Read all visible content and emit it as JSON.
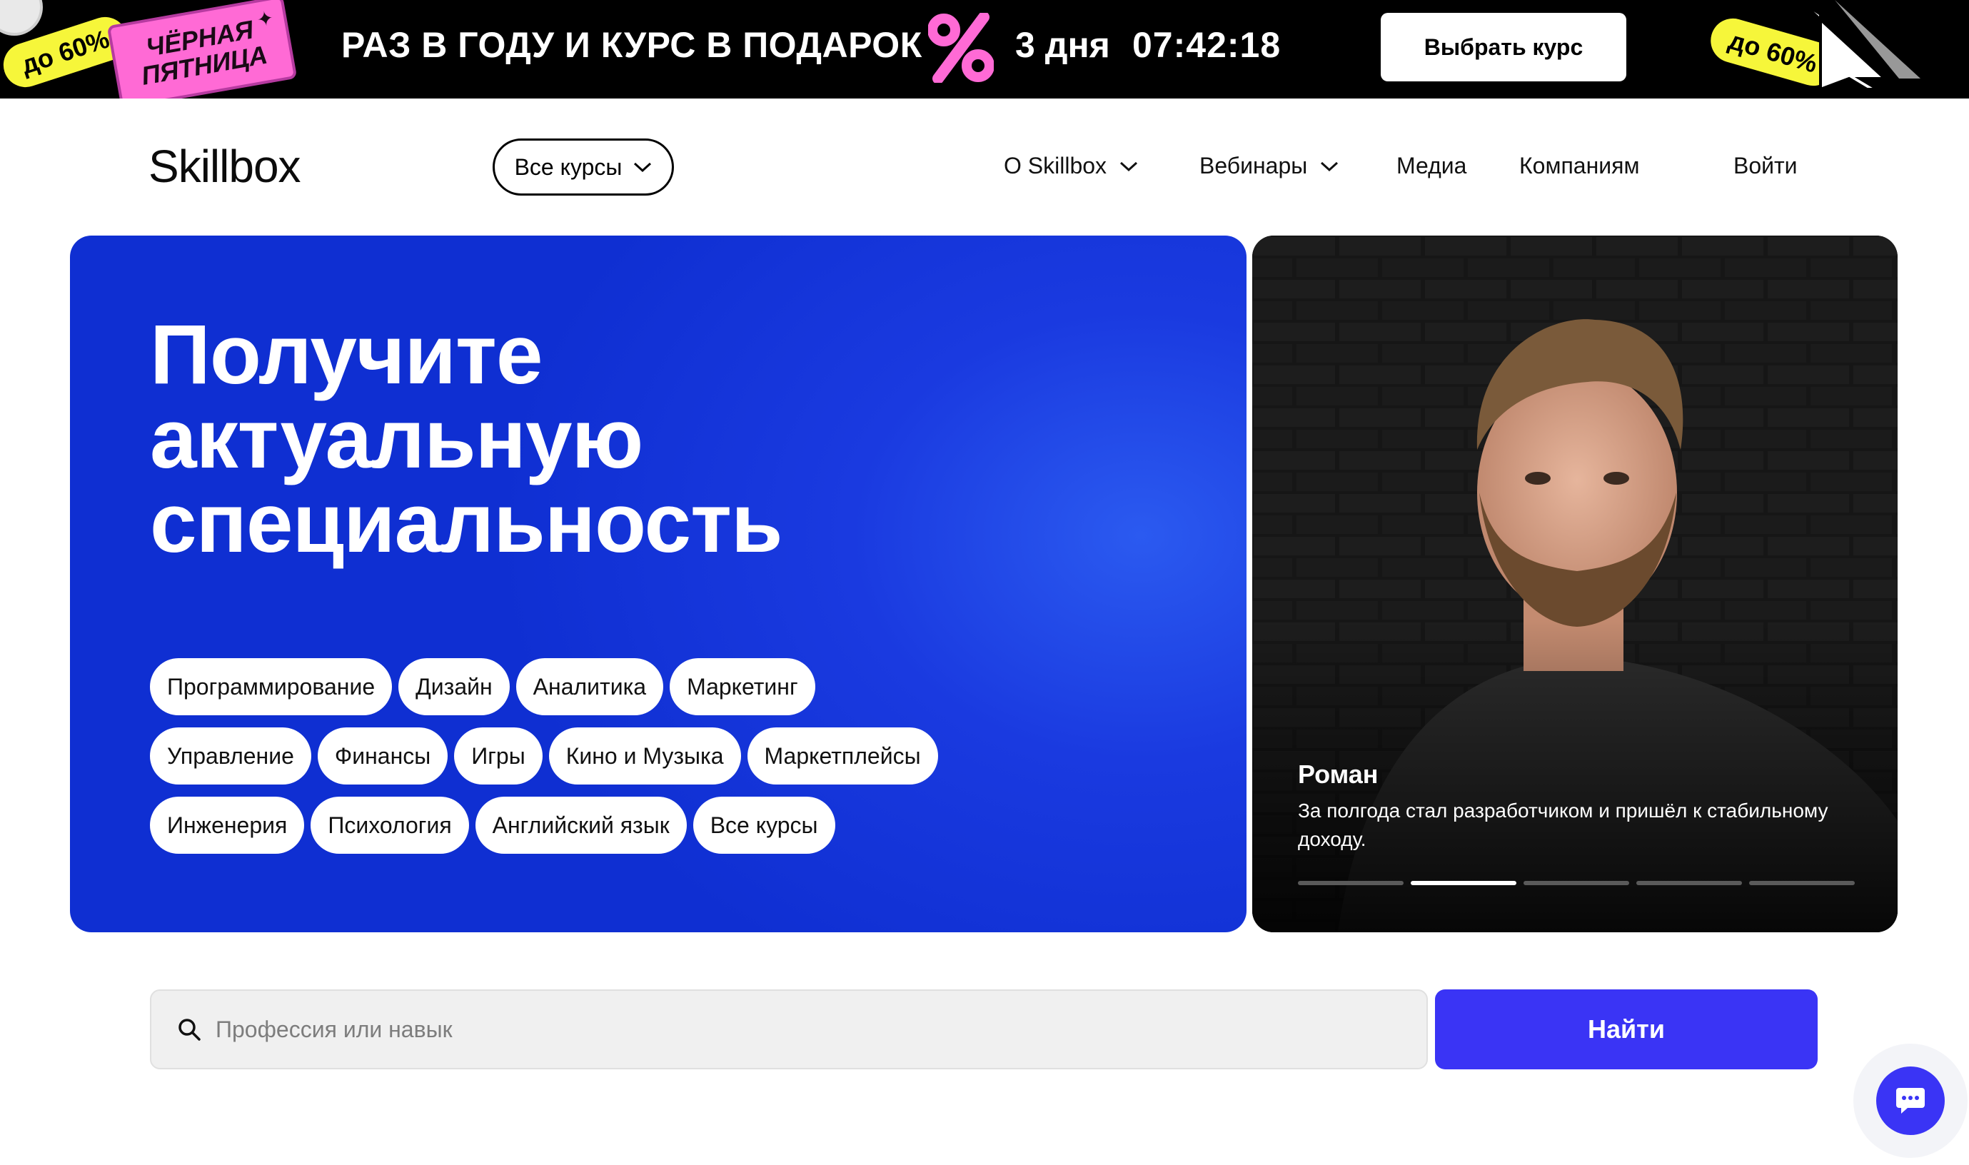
{
  "promo": {
    "badge_left": "до 60%",
    "badge_right": "до 60%",
    "black_friday_line1": "Чёрная",
    "black_friday_line2": "пятница",
    "headline": "РАЗ В ГОДУ И КУРС В ПОДАРОК",
    "days": "3 дня",
    "timer": "07:42:18",
    "cta_label": "Выбрать курс"
  },
  "header": {
    "logo": "Skillbox",
    "all_courses_label": "Все курсы",
    "nav": {
      "about": "О Skillbox",
      "webinars": "Вебинары",
      "media": "Медиа",
      "companies": "Компаниям",
      "login": "Войти"
    }
  },
  "hero": {
    "title_line1": "Получите",
    "title_line2": "актуальную",
    "title_line3": "специальность",
    "chips": [
      [
        "Программирование",
        "Дизайн",
        "Аналитика",
        "Маркетинг"
      ],
      [
        "Управление",
        "Финансы",
        "Игры",
        "Кино и Музыка",
        "Маркетплейсы"
      ],
      [
        "Инженерия",
        "Психология",
        "Английский язык",
        "Все курсы"
      ]
    ]
  },
  "story": {
    "name": "Роман",
    "text": "За полгода стал разработчиком и пришёл к стабильному доходу.",
    "segments_total": 5,
    "active_segment": 2
  },
  "search": {
    "placeholder": "Профессия или навык",
    "value": "",
    "button_label": "Найти"
  },
  "colors": {
    "promo_bg": "#000000",
    "accent_yellow": "#f6f63a",
    "accent_pink": "#ff6ad5",
    "hero_blue": "#1a3ae0",
    "primary_button": "#3a34f5"
  },
  "icons": {
    "search": "search-icon",
    "chevron": "chevron-down-icon",
    "chat": "chat-bubble-icon",
    "percent": "percent-icon",
    "cursor": "pixel-cursor-icon"
  }
}
